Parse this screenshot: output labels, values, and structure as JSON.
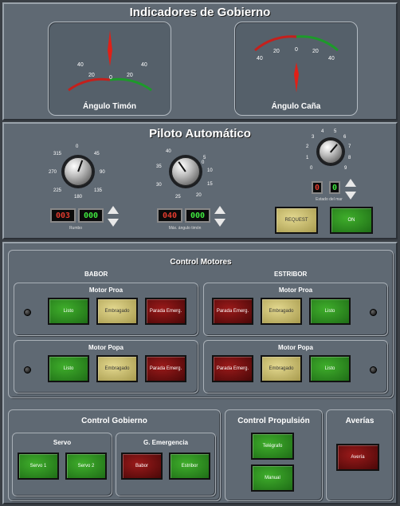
{
  "indicadores": {
    "title": "Indicadores de Gobierno",
    "timon": {
      "label": "Ángulo Timón",
      "ticks": [
        "40",
        "20",
        "0",
        "20",
        "40"
      ]
    },
    "cana": {
      "label": "Ángulo Caña",
      "ticks": [
        "40",
        "20",
        "0",
        "20",
        "40"
      ]
    }
  },
  "piloto": {
    "title": "Piloto Automático",
    "rumbo": {
      "scale": [
        "0",
        "45",
        "90",
        "135",
        "180",
        "225",
        "270",
        "315"
      ],
      "value_red": "003",
      "value_green": "000",
      "label": "Rumbo"
    },
    "maxang": {
      "scale": [
        "0",
        "5",
        "10",
        "15",
        "20",
        "25",
        "30",
        "35",
        "40"
      ],
      "value_red": "040",
      "value_green": "000",
      "label": "Máx. ángulo timón"
    },
    "mar": {
      "scale": [
        "0",
        "1",
        "2",
        "3",
        "4",
        "5",
        "6",
        "7",
        "8",
        "9"
      ],
      "value_red": "0",
      "value_green": "0",
      "label": "Estado del mar"
    },
    "request_label": "REQUEST",
    "on_label": "ON"
  },
  "motores": {
    "title": "Control Motores",
    "babor_label": "BABOR",
    "estribor_label": "ESTRIBOR",
    "babor_proa": {
      "title": "Motor Proa",
      "listo": "Listo",
      "embragado": "Embragado",
      "parada": "Parada Emerg."
    },
    "babor_popa": {
      "title": "Motor Popa",
      "listo": "Listo",
      "embragado": "Embragado",
      "parada": "Parada Emerg."
    },
    "estribor_proa": {
      "title": "Motor Proa",
      "parada": "Parada Emerg.",
      "embragado": "Embragado",
      "listo": "Listo"
    },
    "estribor_popa": {
      "title": "Motor Popa",
      "parada": "Parada Emerg.",
      "embragado": "Embragado",
      "listo": "Listo"
    }
  },
  "gobierno": {
    "title": "Control Gobierno",
    "servo_title": "Servo",
    "servo1": "Servo 1",
    "servo2": "Servo 2",
    "emerg_title": "G. Emergencia",
    "babor": "Babor",
    "estribor": "Estribor"
  },
  "propulsion": {
    "title": "Control Propulsión",
    "telegrafo": "Telégrafo",
    "manual": "Manual"
  },
  "averias": {
    "title": "Averías",
    "averia": "Avería"
  }
}
